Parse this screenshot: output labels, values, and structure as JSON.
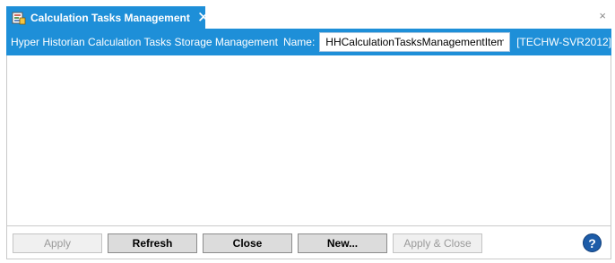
{
  "tab": {
    "title": "Calculation Tasks Management",
    "icon": "calculation-tasks-icon",
    "close_glyph": "✕"
  },
  "strip_close_glyph": "×",
  "header": {
    "title": "Hyper Historian Calculation Tasks Storage Management",
    "name_label": "Name:",
    "name_value": "HHCalculationTasksManagementItem",
    "server": "[TECHW-SVR2012]"
  },
  "buttons": {
    "apply": "Apply",
    "refresh": "Refresh",
    "close": "Close",
    "new": "New...",
    "apply_close": "Apply & Close"
  },
  "help_glyph": "?",
  "colors": {
    "accent": "#1e8fd8",
    "help": "#1d5ca8"
  }
}
